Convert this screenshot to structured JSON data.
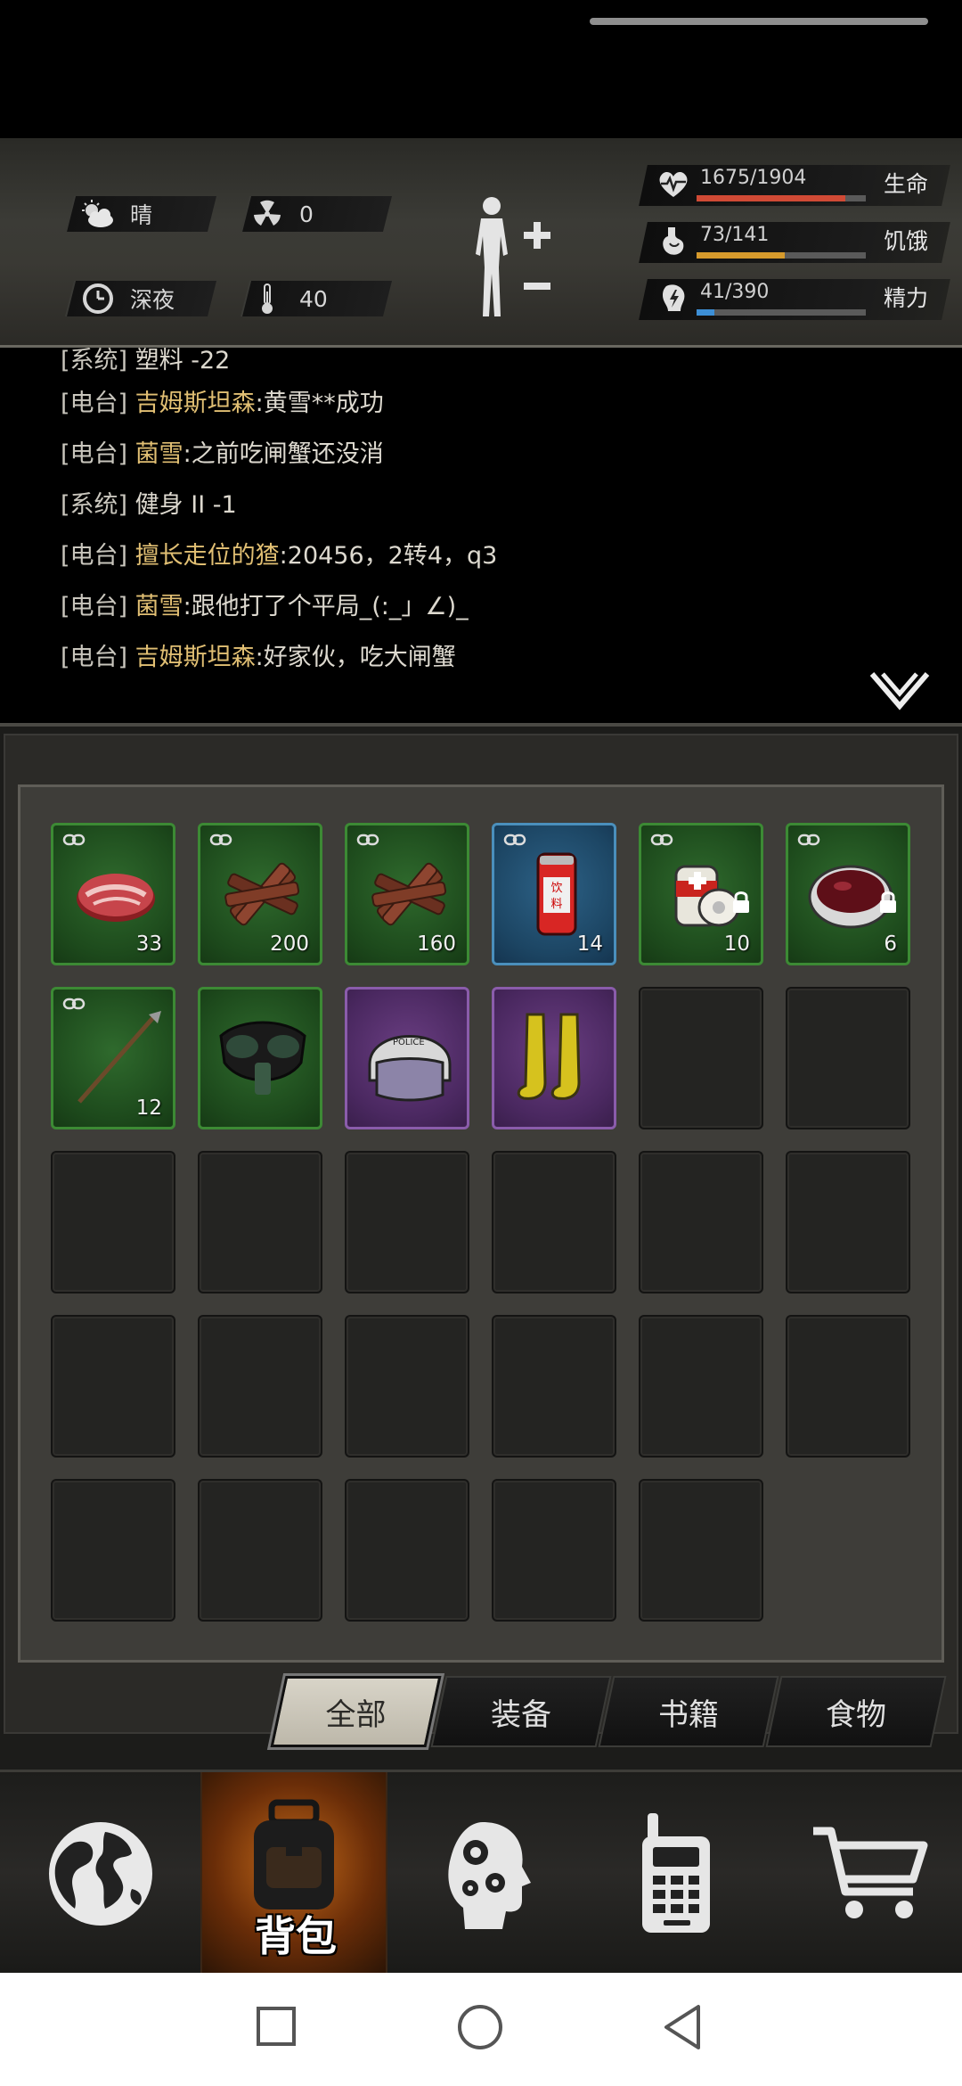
{
  "hud": {
    "weather": "晴",
    "radiation": "0",
    "time_of_day": "深夜",
    "temperature": "40",
    "stats": [
      {
        "label": "生命",
        "value": "1675/1904",
        "fraction": 0.88,
        "color": "#d04a35",
        "icon": "heart-icon"
      },
      {
        "label": "饥饿",
        "value": "73/141",
        "fraction": 0.52,
        "color": "#d69a2c",
        "icon": "stomach-icon"
      },
      {
        "label": "精力",
        "value": "41/390",
        "fraction": 0.105,
        "color": "#3d8fd6",
        "icon": "energy-icon"
      }
    ]
  },
  "chat": {
    "lines": [
      {
        "channel": "[系统]",
        "name": "",
        "msg": "塑料 -22"
      },
      {
        "channel": "[电台]",
        "name": "吉姆斯坦森",
        "msg": ":黄雪**成功"
      },
      {
        "channel": "[电台]",
        "name": "菌雪",
        "msg": ":之前吃闸蟹还没消"
      },
      {
        "channel": "[系统]",
        "name": "",
        "msg": "健身 II -1"
      },
      {
        "channel": "[电台]",
        "name": "擅长走位的猹",
        "msg": ":20456，2转4，q3"
      },
      {
        "channel": "[电台]",
        "name": "菌雪",
        "msg": ":跟他打了个平局_(:_」∠)_"
      },
      {
        "channel": "[电台]",
        "name": "吉姆斯坦森",
        "msg": ":好家伙，吃大闸蟹"
      }
    ]
  },
  "inventory": {
    "items": [
      {
        "name": "steak",
        "rarity": "green",
        "count": "33",
        "linked": true,
        "locked": false
      },
      {
        "name": "wood-sticks",
        "rarity": "green",
        "count": "200",
        "linked": true,
        "locked": false
      },
      {
        "name": "wood-sticks",
        "rarity": "green",
        "count": "160",
        "linked": true,
        "locked": false
      },
      {
        "name": "soda-can",
        "rarity": "blue",
        "count": "14",
        "linked": true,
        "locked": false,
        "label": "饮料"
      },
      {
        "name": "bandage",
        "rarity": "green",
        "count": "10",
        "linked": true,
        "locked": true
      },
      {
        "name": "soup-bowl",
        "rarity": "green",
        "count": "6",
        "linked": true,
        "locked": true
      },
      {
        "name": "spear",
        "rarity": "green",
        "count": "12",
        "linked": true,
        "locked": false
      },
      {
        "name": "gas-mask",
        "rarity": "green",
        "count": "",
        "linked": false,
        "locked": false
      },
      {
        "name": "police-helmet",
        "rarity": "purple",
        "count": "",
        "linked": false,
        "locked": false,
        "label": "POLICE"
      },
      {
        "name": "yellow-boots",
        "rarity": "purple",
        "count": "",
        "linked": false,
        "locked": false
      }
    ],
    "total_slots": 29
  },
  "tabs": [
    {
      "label": "全部",
      "active": true
    },
    {
      "label": "装备",
      "active": false
    },
    {
      "label": "书籍",
      "active": false
    },
    {
      "label": "食物",
      "active": false
    }
  ],
  "bottom_nav": {
    "bag_label": "背包"
  }
}
